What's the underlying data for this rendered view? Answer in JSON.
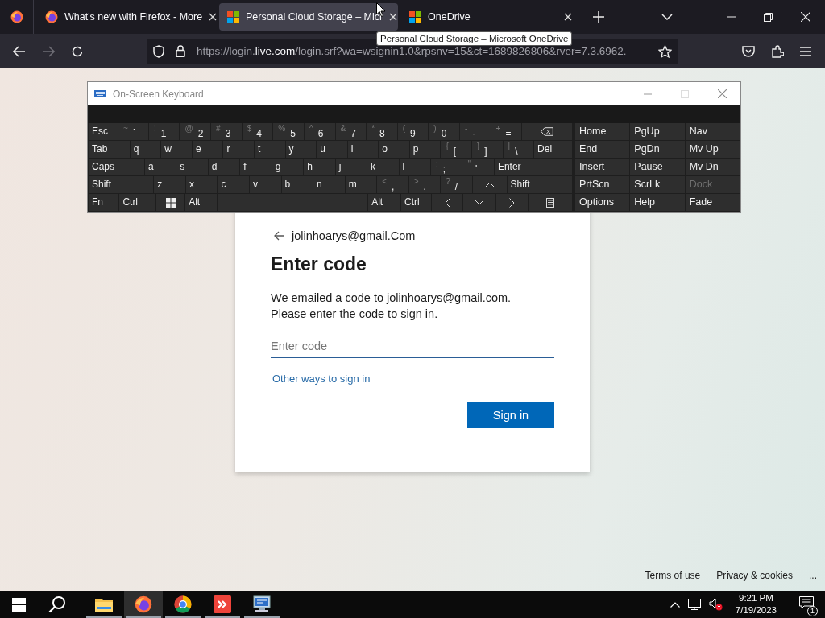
{
  "browser": {
    "tabs": [
      {
        "title": "What's new with Firefox - More",
        "kind": "browser",
        "selected": false
      },
      {
        "title": "Personal Cloud Storage – Micr",
        "kind": "site",
        "selected": true
      },
      {
        "title": "OneDrive",
        "kind": "site",
        "selected": false
      }
    ],
    "tooltip": "Personal Cloud Storage – Microsoft OneDrive",
    "forward_disabled": true,
    "url": "https://login.**live.com**/login.srf?wa=wsignin1.0&rpsnv=15&ct=1689826806&rver=7.3.6962."
  },
  "keyboard": {
    "title": "On-Screen Keyboard",
    "rows": [
      {
        "keys": [
          {
            "kind": "key",
            "label": "Esc"
          },
          {
            "kind": "key",
            "shift": "~",
            "label": "`"
          },
          {
            "kind": "key",
            "shift": "!",
            "label": "1"
          },
          {
            "kind": "key",
            "shift": "@",
            "label": "2"
          },
          {
            "kind": "key",
            "shift": "#",
            "label": "3"
          },
          {
            "kind": "key",
            "shift": "$",
            "label": "4"
          },
          {
            "kind": "key",
            "shift": "%",
            "label": "5"
          },
          {
            "kind": "key",
            "shift": "^",
            "label": "6"
          },
          {
            "kind": "key",
            "shift": "&",
            "label": "7"
          },
          {
            "kind": "key",
            "shift": "*",
            "label": "8"
          },
          {
            "kind": "key",
            "shift": "(",
            "label": "9"
          },
          {
            "kind": "key",
            "shift": ")",
            "label": "0"
          },
          {
            "kind": "key",
            "shift": "-",
            "label": "-"
          },
          {
            "kind": "key",
            "shift": "+",
            "label": "="
          },
          {
            "kind": "backspace"
          }
        ]
      },
      {
        "keys": [
          {
            "kind": "key",
            "label": "Tab"
          },
          {
            "kind": "key",
            "label": "q"
          },
          {
            "kind": "key",
            "label": "w"
          },
          {
            "kind": "key",
            "label": "e"
          },
          {
            "kind": "key",
            "label": "r"
          },
          {
            "kind": "key",
            "label": "t"
          },
          {
            "kind": "key",
            "label": "y"
          },
          {
            "kind": "key",
            "label": "u"
          },
          {
            "kind": "key",
            "label": "i"
          },
          {
            "kind": "key",
            "label": "o"
          },
          {
            "kind": "key",
            "label": "p"
          },
          {
            "kind": "key",
            "shift": "{",
            "label": "["
          },
          {
            "kind": "key",
            "shift": "}",
            "label": "]"
          },
          {
            "kind": "key",
            "shift": "|",
            "label": "\\"
          },
          {
            "kind": "key",
            "label": "Del"
          }
        ]
      },
      {
        "keys": [
          {
            "kind": "key",
            "label": "Caps"
          },
          {
            "kind": "key",
            "label": "a"
          },
          {
            "kind": "key",
            "label": "s"
          },
          {
            "kind": "key",
            "label": "d"
          },
          {
            "kind": "key",
            "label": "f"
          },
          {
            "kind": "key",
            "label": "g"
          },
          {
            "kind": "key",
            "label": "h"
          },
          {
            "kind": "key",
            "label": "j"
          },
          {
            "kind": "key",
            "label": "k"
          },
          {
            "kind": "key",
            "label": "l"
          },
          {
            "kind": "key",
            "shift": ":",
            "label": ";"
          },
          {
            "kind": "key",
            "shift": "\"",
            "label": "'"
          },
          {
            "kind": "key",
            "label": "Enter"
          }
        ]
      },
      {
        "keys": [
          {
            "kind": "key",
            "label": "Shift"
          },
          {
            "kind": "key",
            "label": "z"
          },
          {
            "kind": "key",
            "label": "x"
          },
          {
            "kind": "key",
            "label": "c"
          },
          {
            "kind": "key",
            "label": "v"
          },
          {
            "kind": "key",
            "label": "b"
          },
          {
            "kind": "key",
            "label": "n"
          },
          {
            "kind": "key",
            "label": "m"
          },
          {
            "kind": "key",
            "shift": "<",
            "label": ","
          },
          {
            "kind": "key",
            "shift": ">",
            "label": "."
          },
          {
            "kind": "key",
            "shift": "?",
            "label": "/"
          },
          {
            "kind": "up"
          },
          {
            "kind": "key",
            "label": "Shift"
          }
        ]
      },
      {
        "keys": [
          {
            "kind": "key",
            "label": "Fn"
          },
          {
            "kind": "key",
            "label": "Ctrl"
          },
          {
            "kind": "windows"
          },
          {
            "kind": "key",
            "label": "Alt"
          },
          {
            "kind": "space"
          },
          {
            "kind": "key",
            "label": "Alt"
          },
          {
            "kind": "key",
            "label": "Ctrl"
          },
          {
            "kind": "left"
          },
          {
            "kind": "down"
          },
          {
            "kind": "right"
          },
          {
            "kind": "menu"
          }
        ]
      }
    ],
    "nav_keys": [
      [
        {
          "label": "Home",
          "disabled": false
        },
        {
          "label": "PgUp",
          "disabled": false
        },
        {
          "label": "Nav",
          "disabled": false
        }
      ],
      [
        {
          "label": "End",
          "disabled": false
        },
        {
          "label": "PgDn",
          "disabled": false
        },
        {
          "label": "Mv Up",
          "disabled": false
        }
      ],
      [
        {
          "label": "Insert",
          "disabled": false
        },
        {
          "label": "Pause",
          "disabled": false
        },
        {
          "label": "Mv Dn",
          "disabled": false
        }
      ],
      [
        {
          "label": "PrtScn",
          "disabled": false
        },
        {
          "label": "ScrLk",
          "disabled": false
        },
        {
          "label": "Dock",
          "disabled": true
        }
      ],
      [
        {
          "label": "Options",
          "disabled": false
        },
        {
          "label": "Help",
          "disabled": false
        },
        {
          "label": "Fade",
          "disabled": false
        }
      ]
    ]
  },
  "signin": {
    "email": "jolinhoarys@gmail.Com",
    "heading": "Enter code",
    "message_lines": [
      "We emailed a code to jolinhoarys@gmail.com.",
      "Please enter the code to sign in."
    ],
    "code_field": {
      "placeholder": "Enter code"
    },
    "other_link": "Other ways to sign in",
    "button": "Sign in"
  },
  "footer": [
    "Terms of use",
    "Privacy & cookies",
    "..."
  ],
  "taskbar": {
    "apps": [
      {
        "running": true,
        "selected": false
      },
      {
        "running": true,
        "selected": true
      },
      {
        "running": true,
        "selected": false
      },
      {
        "running": true,
        "selected": false
      },
      {
        "running": true,
        "selected": false
      }
    ],
    "time": "9:21 PM",
    "date": "7/19/2023",
    "notifications": "1"
  }
}
